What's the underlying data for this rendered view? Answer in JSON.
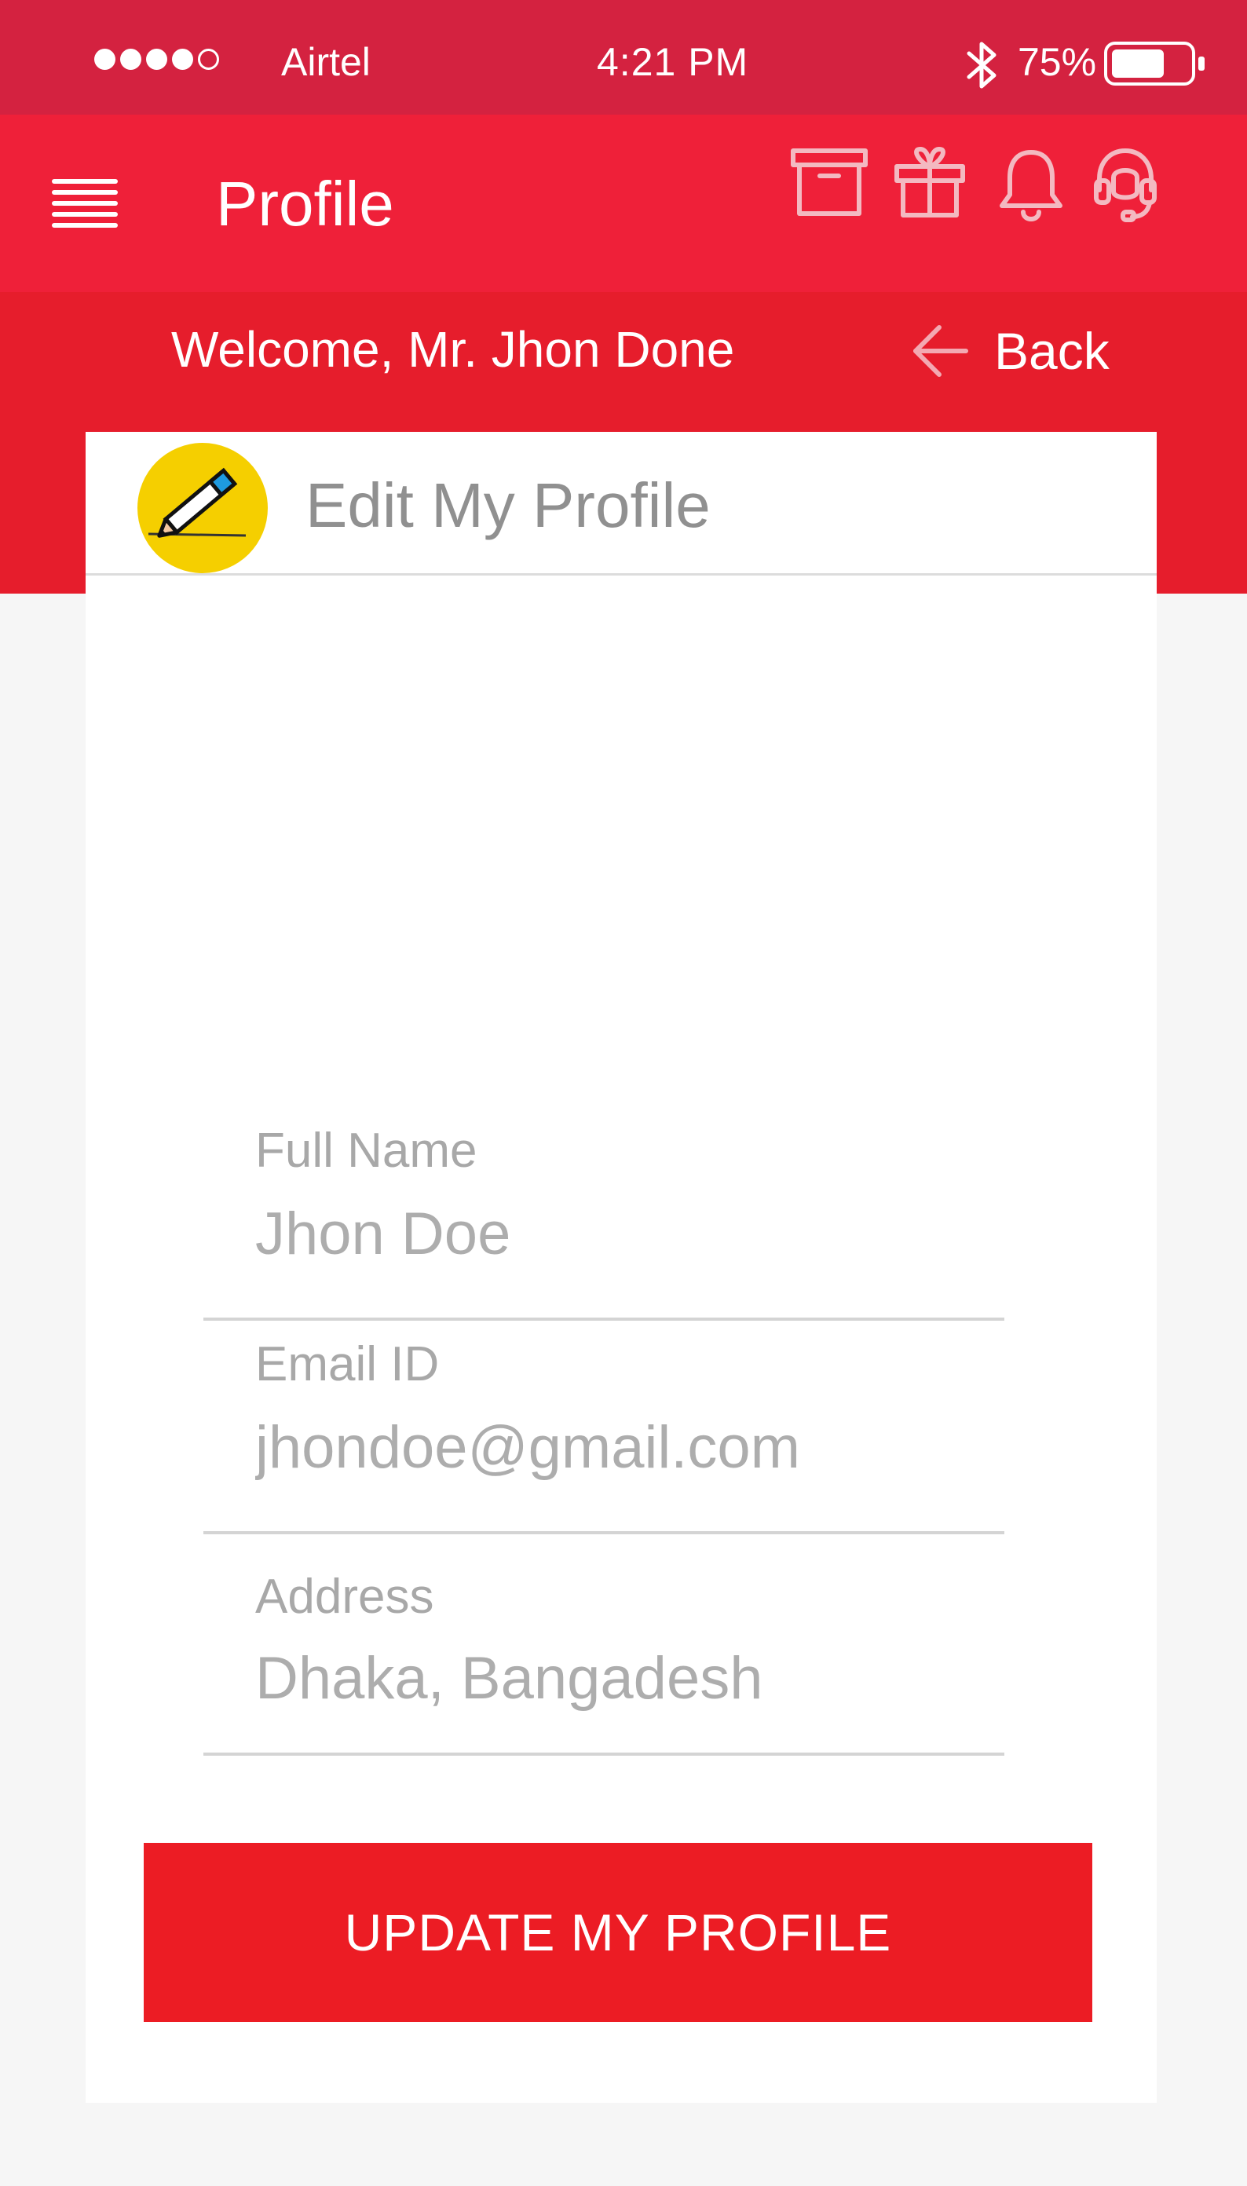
{
  "status_bar": {
    "carrier": "Airtel",
    "time": "4:21  PM",
    "battery_percent": "75%",
    "signal_strength": "4 of 5"
  },
  "app_bar": {
    "title": "Profile",
    "icons": [
      "menu-icon",
      "archive-box-icon",
      "gift-icon",
      "bell-icon",
      "headset-support-icon"
    ]
  },
  "sub_bar": {
    "welcome_text": "Welcome, Mr. Jhon Done",
    "back_label": "Back"
  },
  "card": {
    "title": "Edit My Profile",
    "header_icon": "pencil-edit-icon",
    "fields": [
      {
        "label": "Full Name",
        "value": "Jhon Doe"
      },
      {
        "label": "Email ID",
        "value": "jhondoe@gmail.com"
      },
      {
        "label": "Address",
        "value": "Dhaka, Bangadesh"
      }
    ],
    "update_button_label": "UPDATE MY PROFILE"
  },
  "colors": {
    "status_bar": "#d42240",
    "app_bar": "#ef2039",
    "sub_bar": "#e61d2c",
    "button": "#ec1c24",
    "avatar": "#f5cf00",
    "page_background": "#f6f6f6"
  }
}
